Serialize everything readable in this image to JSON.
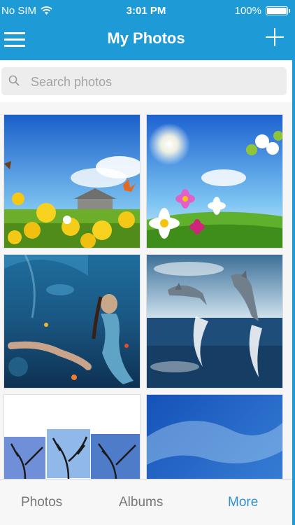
{
  "status": {
    "carrier": "No SIM",
    "time": "3:01 PM",
    "battery": "100%"
  },
  "nav": {
    "title": "My Photos",
    "menu_icon": "hamburger-menu-icon",
    "add_icon": "plus-icon"
  },
  "search": {
    "placeholder": "Search photos",
    "icon": "search-icon"
  },
  "photos": [
    {
      "subject": "yellow-flowers-butterflies"
    },
    {
      "subject": "sunny-sky-daisies"
    },
    {
      "subject": "underwater-mermaid"
    },
    {
      "subject": "jumping-dolphins"
    },
    {
      "subject": "bare-tree-collage"
    },
    {
      "subject": "blue-sky-clouds"
    }
  ],
  "tabs": {
    "photos": "Photos",
    "albums": "Albums",
    "more": "More"
  },
  "colors": {
    "header": "#1e9ad6",
    "active_tab": "#2f8fd1",
    "inactive_tab": "#777777"
  }
}
